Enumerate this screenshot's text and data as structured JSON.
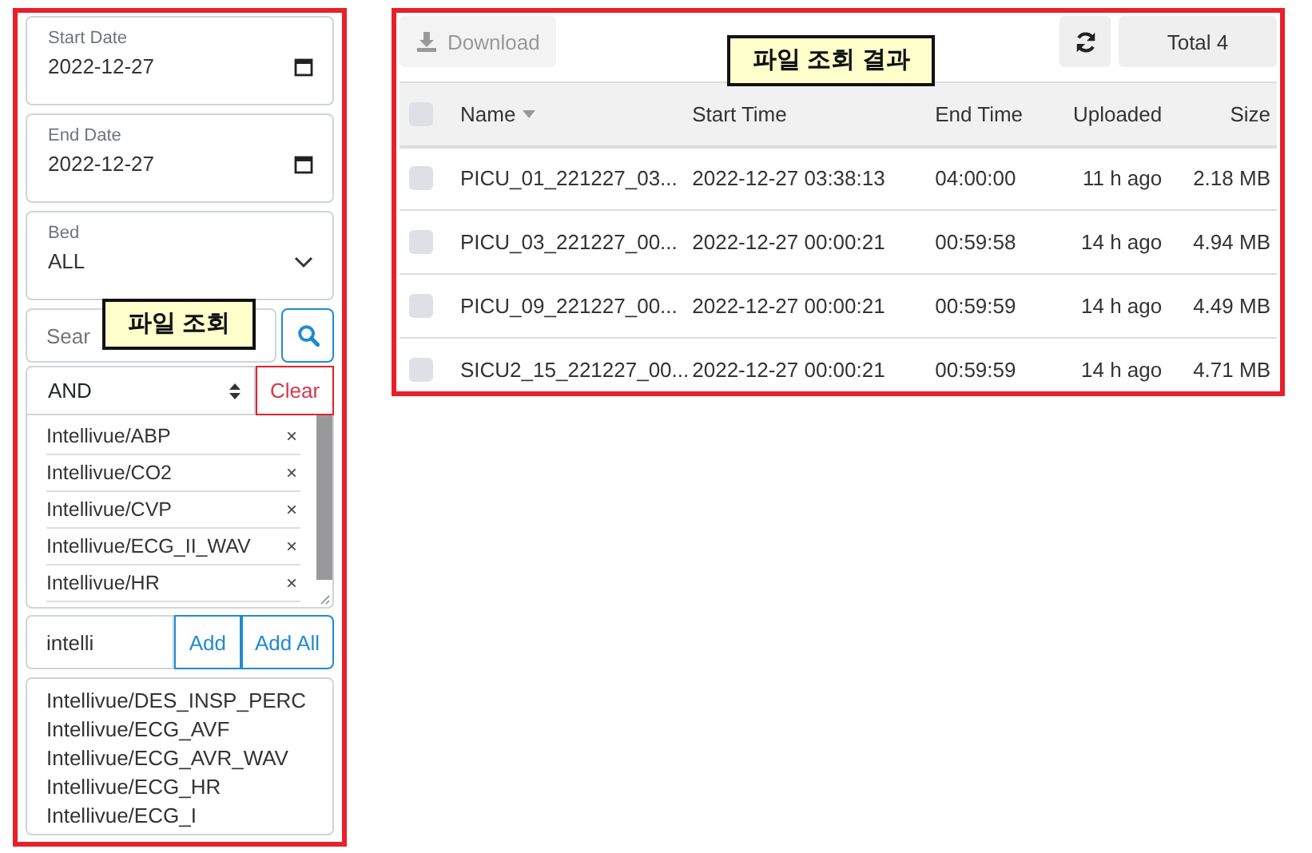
{
  "filters": {
    "start_date": {
      "label": "Start Date",
      "value": "2022-12-27"
    },
    "end_date": {
      "label": "End Date",
      "value": "2022-12-27"
    },
    "bed": {
      "label": "Bed",
      "value": "ALL"
    },
    "search": {
      "placeholder": "Sear"
    },
    "operator": {
      "value": "AND",
      "clear_label": "Clear"
    },
    "selected_signals": [
      {
        "label": "Intellivue/ABP",
        "remove": "×"
      },
      {
        "label": "Intellivue/CO2",
        "remove": "×"
      },
      {
        "label": "Intellivue/CVP",
        "remove": "×"
      },
      {
        "label": "Intellivue/ECG_II_WAV",
        "remove": "×"
      },
      {
        "label": "Intellivue/HR",
        "remove": "×"
      }
    ],
    "signal_input": {
      "value": "intelli",
      "add_label": "Add",
      "add_all_label": "Add All"
    },
    "signal_options": [
      "Intellivue/DES_INSP_PERC",
      "Intellivue/ECG_AVF",
      "Intellivue/ECG_AVR_WAV",
      "Intellivue/ECG_HR",
      "Intellivue/ECG_I"
    ],
    "callout": "파일 조회"
  },
  "results": {
    "download_label": "Download",
    "download_disabled": true,
    "total": "Total 4",
    "callout": "파일 조회 결과",
    "select_all_checked": false,
    "columns": [
      "Name",
      "Start Time",
      "End Time",
      "Uploaded",
      "Size"
    ],
    "rows": [
      {
        "checked": false,
        "cells": [
          "PICU_01_221227_03...",
          "2022-12-27 03:38:13",
          "04:00:00",
          "11 h ago",
          "2.18 MB"
        ]
      },
      {
        "checked": false,
        "cells": [
          "PICU_03_221227_00...",
          "2022-12-27 00:00:21",
          "00:59:58",
          "14 h ago",
          "4.94 MB"
        ]
      },
      {
        "checked": false,
        "cells": [
          "PICU_09_221227_00...",
          "2022-12-27 00:00:21",
          "00:59:59",
          "14 h ago",
          "4.49 MB"
        ]
      },
      {
        "checked": false,
        "cells": [
          "SICU2_15_221227_00...",
          "2022-12-27 00:00:21",
          "00:59:59",
          "14 h ago",
          "4.71 MB"
        ]
      }
    ]
  }
}
